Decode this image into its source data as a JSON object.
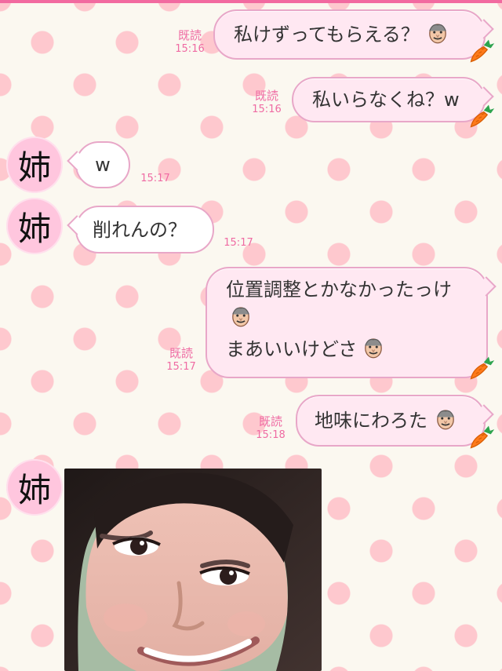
{
  "messages": [
    {
      "side": "right",
      "read": "既読",
      "time": "15:16",
      "text": "私けずってもらえる？",
      "emoji": "old-man",
      "carrot": true
    },
    {
      "side": "right",
      "read": "既読",
      "time": "15:16",
      "text": "私いらなくね？w",
      "carrot": true
    },
    {
      "side": "left",
      "avatar": "姉",
      "time": "15:17",
      "text": "w"
    },
    {
      "side": "left",
      "avatar": "姉",
      "time": "15:17",
      "text": "削れんの？"
    },
    {
      "side": "right",
      "read": "既読",
      "time": "15:17",
      "line1": "位置調整とかなかったっけ",
      "line2": "まあいいけどさ",
      "emoji": "old-man",
      "carrot": true
    },
    {
      "side": "right",
      "read": "既読",
      "time": "15:18",
      "text": "地味にわろた",
      "emoji": "old-man",
      "carrot": true
    },
    {
      "side": "left",
      "avatar": "姉",
      "image": "selfie-photo"
    }
  ],
  "colors": {
    "accent_pink": "#ef6ba3",
    "bubble_pink": "#ffe8f2",
    "bubble_border": "#e8a7c8",
    "avatar_pink": "#ffc6de",
    "background": "#fbf8f0",
    "dot": "#ffb6c1"
  },
  "icons": {
    "emoji": "old-man-icon",
    "carrot": "carrot-icon",
    "photo": "photo"
  }
}
